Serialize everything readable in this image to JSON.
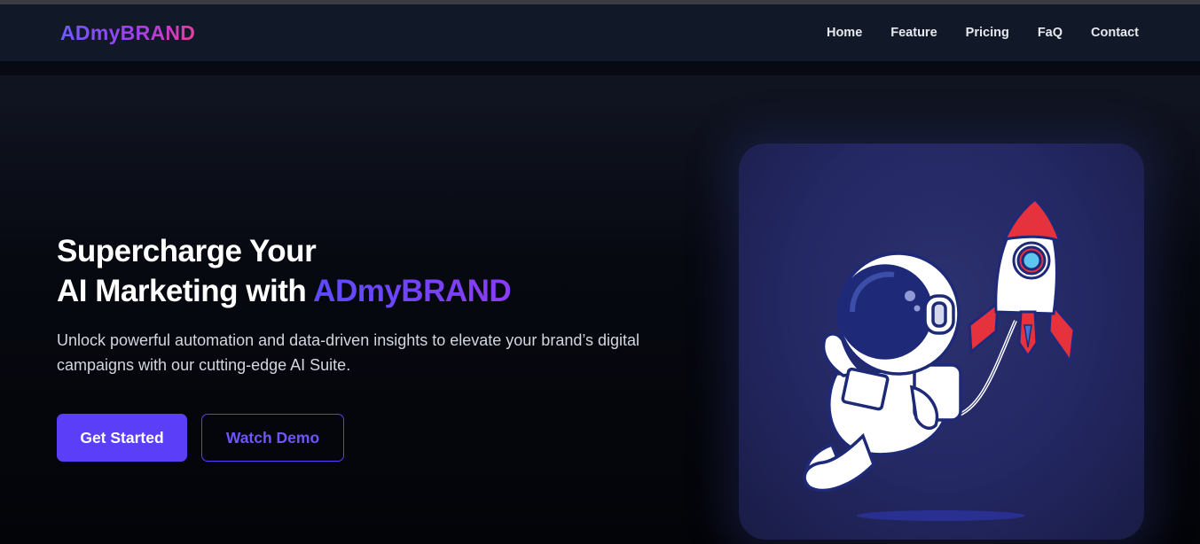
{
  "nav": {
    "logo": "ADmyBRAND",
    "links": [
      "Home",
      "Feature",
      "Pricing",
      "FaQ",
      "Contact"
    ]
  },
  "hero": {
    "headline_line1": "Supercharge Your",
    "headline_line2_prefix": "AI Marketing with ",
    "headline_brand": "ADmyBRAND",
    "subtext": "Unlock powerful automation and data-driven insights to elevate your brand’s digital campaigns with our cutting-edge AI Suite.",
    "primary_button": "Get Started",
    "secondary_button": "Watch Demo"
  },
  "illustration": {
    "name": "astronaut-with-rocket-illustration"
  },
  "colors": {
    "accent": "#5b3ef8",
    "navbar_bg": "#111827",
    "page_bg": "#05060b",
    "rocket_red": "#e6323c"
  }
}
